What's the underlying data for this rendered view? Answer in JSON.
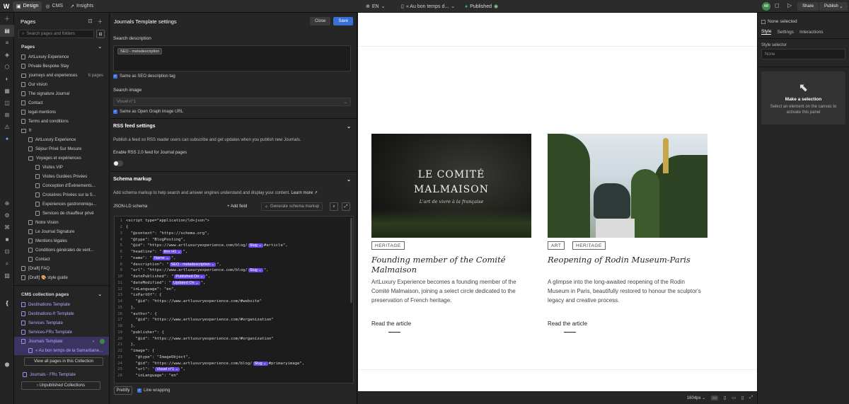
{
  "topbar": {
    "tabs": [
      {
        "label": "Design"
      },
      {
        "label": "CMS"
      },
      {
        "label": "Insights"
      }
    ],
    "locale": "EN",
    "page_selector": "« Au bon temps d...",
    "status": "Published",
    "avatar": "AB",
    "share_label": "Share",
    "publish_label": "Publish"
  },
  "pages_panel": {
    "title": "Pages",
    "search_placeholder": "Search pages and folders",
    "pages_section": "Pages",
    "items": [
      {
        "label": "ArtLuxury Experience"
      },
      {
        "label": "Private Bespoke Stay"
      },
      {
        "label": "journeys and experiences",
        "count": "6 pages"
      },
      {
        "label": "Our vision"
      },
      {
        "label": "The signature Journal"
      },
      {
        "label": "Contact"
      },
      {
        "label": "legal-mentions"
      },
      {
        "label": "Terms and conditions"
      },
      {
        "label": "fr"
      },
      {
        "label": "ArtLuxury Experience"
      },
      {
        "label": "Séjour Privé Sur Mesure"
      },
      {
        "label": "Voyages et expériences"
      },
      {
        "label": "Visites VIP"
      },
      {
        "label": "Visites Guidées Privées"
      },
      {
        "label": "Conception d'Événements..."
      },
      {
        "label": "Croisières Privées sur la S..."
      },
      {
        "label": "Expériences gastronomiqu..."
      },
      {
        "label": "Services de chauffeur privé"
      },
      {
        "label": "Notre Vision"
      },
      {
        "label": "Le Journal Signature"
      },
      {
        "label": "Mentions légales"
      },
      {
        "label": "Conditions générales de vent..."
      },
      {
        "label": "Contact"
      },
      {
        "label": "[Draft] FAQ"
      },
      {
        "label": "[Draft] 🎨 style guide"
      }
    ],
    "cms_section": "CMS collection pages",
    "cms_items": [
      {
        "label": "Destinations Template"
      },
      {
        "label": "Destinations-fr Template"
      },
      {
        "label": "Services Template"
      },
      {
        "label": "Services-FRs Template"
      },
      {
        "label": "Journals Template"
      },
      {
        "label": "« Au bon temps de la Samaritaine..."
      }
    ],
    "view_all_label": "View all pages in this Collection",
    "frs_template": "Journals - FRs Template",
    "unpublished_label": "Unpublished Collections"
  },
  "settings": {
    "title": "Journals Template settings",
    "close_label": "Close",
    "save_label": "Save",
    "search_desc_label": "Search description",
    "search_desc_tag": "SEO - metadescription",
    "same_as_seo": "Same as SEO description tag",
    "search_image_label": "Search image",
    "search_image_value": "Visuel n°1",
    "same_as_og": "Same as Open Graph image URL",
    "rss_title": "RSS feed settings",
    "rss_desc": "Publish a feed so RSS reader users can subscribe and get updates when you publish new Journals.",
    "rss_enable": "Enable RSS 2.0 feed for Journal pages",
    "schema_title": "Schema markup",
    "schema_desc": "Add schema markup to help search and answer engines understand and display your content.",
    "learn_more": "Learn more",
    "jsonld_label": "JSON-LD schema",
    "add_field": "+ Add field",
    "generate": "Generate schema markup",
    "prettify": "Prettify",
    "line_wrapping": "Line wrapping"
  },
  "canvas": {
    "cards": [
      {
        "image_text_1": "LE COMITÉ",
        "image_text_2": "MALMAISON",
        "image_text_3": "L'art de vivre à la française",
        "tags": [
          "HERITAGE"
        ],
        "title": "Founding member of the Comité Malmaison",
        "text": "ArtLuxury Experience becomes a founding member of the Comité Malmaison, joining a select circle dedicated to the preservation of French heritage.",
        "link": "Read the article"
      },
      {
        "tags": [
          "ART",
          "HERITAGE"
        ],
        "title": "Reopening of Rodin Museum-Paris",
        "text": "A glimpse into the long-awaited reopening of the Rodin Museum in Paris, beautifully restored to honour the sculptor's legacy and creative process.",
        "link": "Read the article"
      }
    ],
    "width_label": "1604px"
  },
  "right_panel": {
    "none_selected": "None selected",
    "tabs": [
      {
        "label": "Style"
      },
      {
        "label": "Settings"
      },
      {
        "label": "Interactions"
      }
    ],
    "style_selector_label": "Style selector",
    "style_selector_value": "None",
    "make_selection": "Make a selection",
    "make_selection_desc": "Select an element on the canvas to activate this panel"
  }
}
